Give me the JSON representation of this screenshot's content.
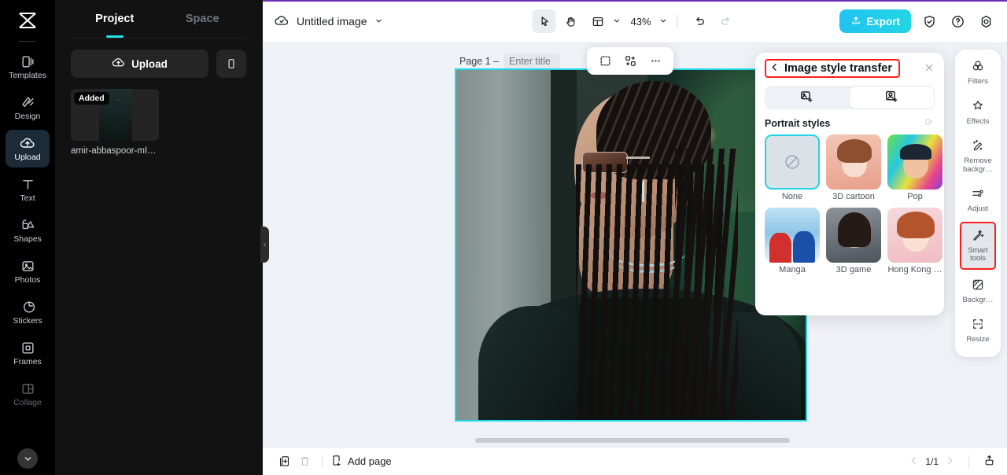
{
  "rail": {
    "logo_icon": "capcut-logo-icon",
    "items": [
      {
        "label": "Templates",
        "icon": "templates-icon",
        "active": false
      },
      {
        "label": "Design",
        "icon": "design-icon",
        "active": false
      },
      {
        "label": "Upload",
        "icon": "upload-cloud-icon",
        "active": true
      },
      {
        "label": "Text",
        "icon": "text-icon",
        "active": false
      },
      {
        "label": "Shapes",
        "icon": "shapes-icon",
        "active": false
      },
      {
        "label": "Photos",
        "icon": "photos-icon",
        "active": false
      },
      {
        "label": "Stickers",
        "icon": "stickers-icon",
        "active": false
      },
      {
        "label": "Frames",
        "icon": "frames-icon",
        "active": false
      },
      {
        "label": "Collage",
        "icon": "collage-icon",
        "active": false
      }
    ],
    "expand_icon": "chevron-down-icon"
  },
  "panel": {
    "tabs": [
      {
        "label": "Project",
        "active": true
      },
      {
        "label": "Space",
        "active": false
      }
    ],
    "upload_label": "Upload",
    "upload_icon": "upload-cloud-icon",
    "mobile_icon": "mobile-phone-icon",
    "asset": {
      "badge": "Added",
      "name": "amir-abbaspoor-mIN…"
    },
    "collapse_icon": "chevron-left-icon"
  },
  "topbar": {
    "cloud_icon": "cloud-saved-icon",
    "doc_title": "Untitled image",
    "title_caret": "chevron-down-icon",
    "tools": [
      {
        "name": "select-tool",
        "icon": "cursor-arrow-icon",
        "selected": true
      },
      {
        "name": "hand-tool",
        "icon": "hand-icon",
        "selected": false
      },
      {
        "name": "layout-tool",
        "icon": "layout-icon",
        "selected": false
      }
    ],
    "zoom_level": "43%",
    "zoom_caret": "chevron-down-icon",
    "undo_icon": "undo-icon",
    "redo_icon": "redo-icon",
    "export_label": "Export",
    "export_icon": "export-upload-icon",
    "export_color": "#22cfe4",
    "shield_icon": "shield-check-icon",
    "help_icon": "help-circle-icon",
    "settings_icon": "settings-gear-icon"
  },
  "canvas": {
    "page_label": "Page 1 –",
    "title_placeholder": "Enter title",
    "title_value": "",
    "float_tools": [
      {
        "name": "crop-select-icon"
      },
      {
        "name": "replace-image-icon"
      },
      {
        "name": "more-options-icon"
      }
    ],
    "selection_color": "#20d8e8"
  },
  "style_panel": {
    "back_icon": "chevron-left-icon",
    "title": "Image style transfer",
    "title_highlight_color": "#ff1d1d",
    "close_icon": "close-icon",
    "tabs": [
      {
        "name": "image-style-tab",
        "icon": "image-style-icon",
        "active": false
      },
      {
        "name": "portrait-style-tab",
        "icon": "portrait-style-icon",
        "active": true
      }
    ],
    "section_title": "Portrait styles",
    "section_icon": "collapse-panel-icon",
    "styles": [
      {
        "label": "None",
        "icon": "no-style-icon",
        "selected": true,
        "art": "none"
      },
      {
        "label": "3D cartoon",
        "selected": false,
        "art": "cartoon"
      },
      {
        "label": "Pop",
        "selected": false,
        "art": "pop"
      },
      {
        "label": "Manga",
        "selected": false,
        "art": "manga"
      },
      {
        "label": "3D game",
        "selected": false,
        "art": "3dgame"
      },
      {
        "label": "Hong Kong …",
        "selected": false,
        "art": "hk"
      }
    ]
  },
  "right_tools": {
    "items": [
      {
        "label": "Filters",
        "icon": "filters-icon",
        "selected": false,
        "highlighted": false
      },
      {
        "label": "Effects",
        "icon": "effects-icon",
        "selected": false,
        "highlighted": false
      },
      {
        "label": "Remove backgr…",
        "icon": "remove-background-icon",
        "selected": false,
        "highlighted": false
      },
      {
        "label": "Adjust",
        "icon": "adjust-sliders-icon",
        "selected": false,
        "highlighted": false
      },
      {
        "label": "Smart tools",
        "icon": "magic-wand-icon",
        "selected": true,
        "highlighted": true
      },
      {
        "label": "Backgr…",
        "icon": "background-icon",
        "selected": false,
        "highlighted": false
      },
      {
        "label": "Resize",
        "icon": "resize-icon",
        "selected": false,
        "highlighted": false
      }
    ],
    "highlight_color": "#ff1d1d"
  },
  "bottombar": {
    "duplicate_icon": "duplicate-page-icon",
    "delete_icon": "delete-trash-icon",
    "add_page_label": "Add page",
    "add_page_icon": "add-page-icon",
    "prev_icon": "chevron-left-icon",
    "page_indicator": "1/1",
    "next_icon": "chevron-right-icon",
    "export_icon": "export-tray-icon"
  }
}
